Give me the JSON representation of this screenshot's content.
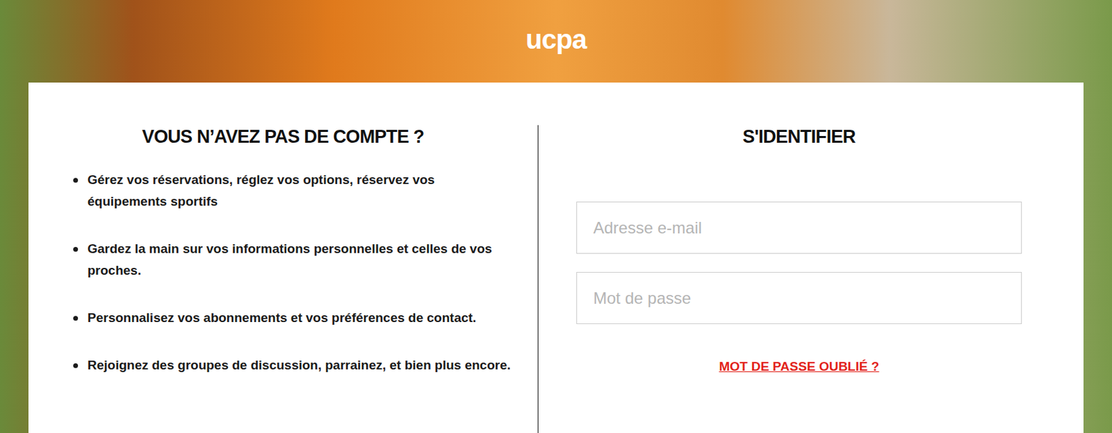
{
  "header": {
    "logo": "ucpa"
  },
  "signup": {
    "title": "VOUS N’AVEZ PAS DE COMPTE ?",
    "benefits": [
      "Gérez vos réservations, réglez vos options, réservez vos équipements sportifs",
      "Gardez la main sur vos informations personnelles et celles de vos proches.",
      "Personnalisez vos abonnements et vos préférences de contact.",
      "Rejoignez des groupes de discussion, parrainez, et bien plus encore."
    ]
  },
  "login": {
    "title": "S'IDENTIFIER",
    "fields": [
      {
        "placeholder": "Adresse e-mail",
        "type": "email"
      },
      {
        "placeholder": "Mot de passe",
        "type": "password"
      }
    ],
    "forgot_link": "MOT DE PASSE OUBLIÉ ?"
  }
}
